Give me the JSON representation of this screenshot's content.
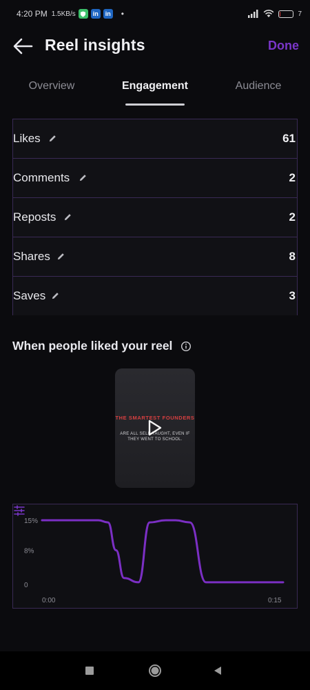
{
  "status_bar": {
    "time": "4:20 PM",
    "speed": "1.5KB/s",
    "battery_percent": 7,
    "battery_label": "7"
  },
  "header": {
    "title": "Reel insights",
    "done_label": "Done"
  },
  "tabs": [
    {
      "label": "Overview",
      "active": false
    },
    {
      "label": "Engagement",
      "active": true
    },
    {
      "label": "Audience",
      "active": false
    }
  ],
  "metrics": [
    {
      "label": "Likes",
      "value": "61"
    },
    {
      "label": "Comments",
      "value": "2"
    },
    {
      "label": "Reposts",
      "value": "2"
    },
    {
      "label": "Shares",
      "value": "8"
    },
    {
      "label": "Saves",
      "value": "3"
    }
  ],
  "likes_section": {
    "title": "When people liked your reel"
  },
  "reel_preview": {
    "headline": "THE SMARTEST FOUNDERS",
    "subtext": "ARE ALL SELF-TAUGHT, EVEN IF THEY WENT TO SCHOOL."
  },
  "chart_data": {
    "type": "line",
    "y_ticks": [
      "15%",
      "8%",
      "0"
    ],
    "x_ticks": [
      "0:00",
      "0:15"
    ],
    "ylim": [
      0,
      15
    ],
    "xlim": [
      0,
      15
    ],
    "series": [
      {
        "color": "#7b2fc4",
        "x": [
          0,
          3.5,
          4.1,
          4.6,
          5.1,
          6.0,
          6.7,
          7.7,
          8.3,
          9.2,
          10.2,
          15
        ],
        "y": [
          15,
          15,
          14.5,
          8,
          1.5,
          0.5,
          14.5,
          15,
          15,
          14.5,
          0.5,
          0.5
        ]
      }
    ]
  },
  "colors": {
    "accent": "#7a36c9",
    "line": "#7b2fc4",
    "border": "#3a2a55"
  }
}
